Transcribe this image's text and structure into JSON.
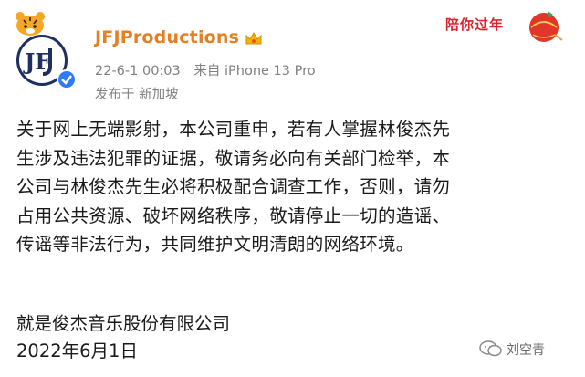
{
  "header": {
    "username": "JFJProductions",
    "timestamp": "22-6-1 00:03",
    "source": "来自 iPhone 13 Pro",
    "location": "发布于 新加坡",
    "badge_text": "陪你过年",
    "avatar_icon": "jfj-logo-icon",
    "verified_icon": "verified-check-icon",
    "crown_icon": "crown-icon"
  },
  "post": {
    "lines": [
      "关于网上无端影射，本公司重申，若有人掌握林俊杰先",
      "生涉及违法犯罪的证据，敬请务必向有关部门检举，本",
      "公司与林俊杰先生必将积极配合调查工作，否则，请勿",
      "占用公共资源、破坏网络秩序，敬请停止一切的造谣、",
      "传谣等非法行为，共同维护文明清朗的网络环境。"
    ],
    "signature_company": "就是俊杰音乐股份有限公司",
    "signature_date": "2022年6月1日"
  },
  "watermark": {
    "text": "刘空青",
    "icon": "wechat-icon"
  },
  "colors": {
    "username": "#e67e22",
    "meta": "#808080",
    "verified": "#2f7bf6",
    "badge": "#d8262d"
  }
}
